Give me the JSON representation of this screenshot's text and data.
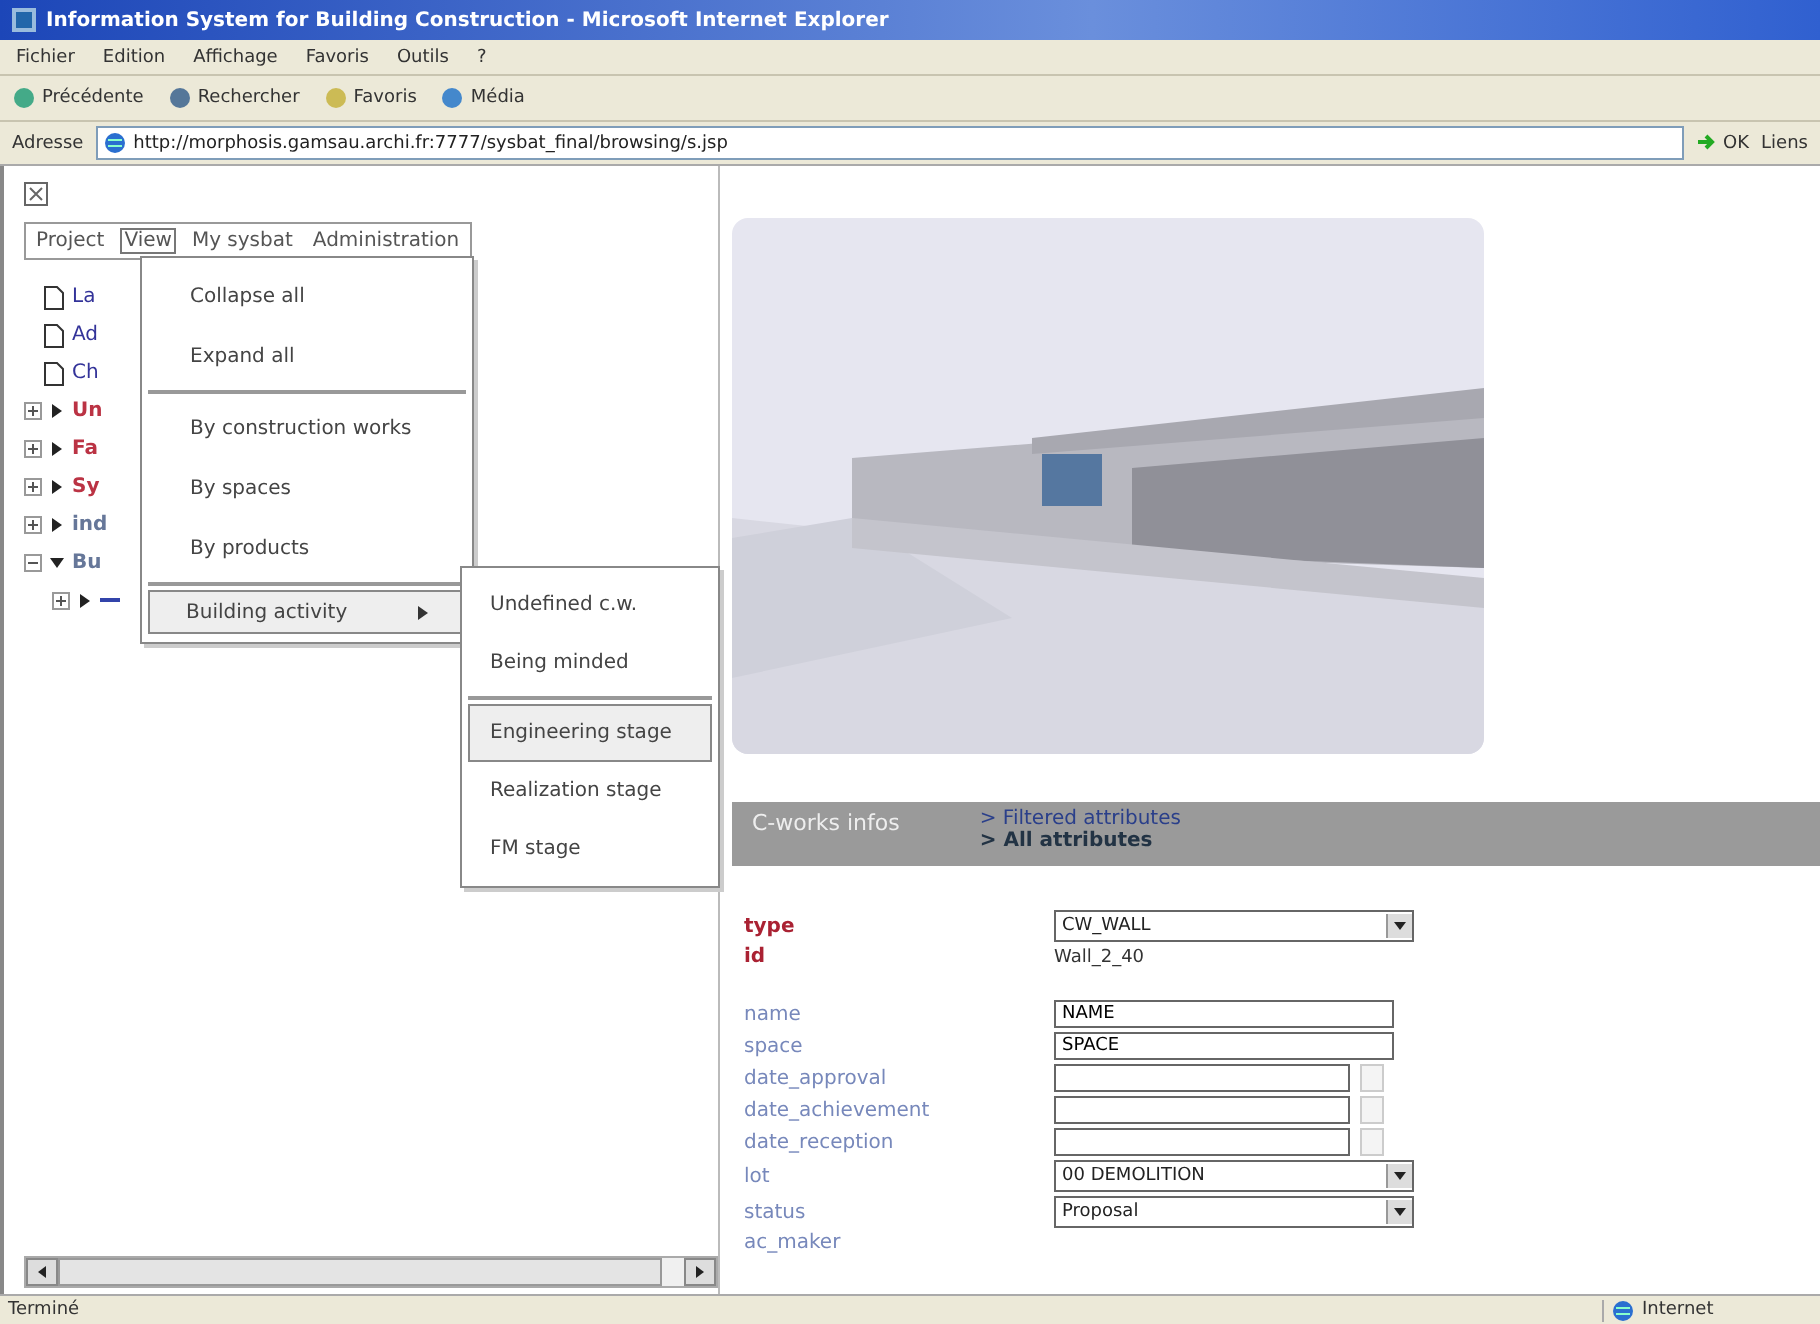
{
  "window": {
    "title": "Information System for Building Construction - Microsoft Internet Explorer"
  },
  "menu_bar": [
    "Fichier",
    "Edition",
    "Affichage",
    "Favoris",
    "Outils",
    "?"
  ],
  "toolbar": [
    "Précédente",
    "Rechercher",
    "Favoris",
    "Média"
  ],
  "address": {
    "label": "Adresse",
    "url": "http://morphosis.gamsau.archi.fr:7777/sysbat_final/browsing/s.jsp",
    "go": "OK",
    "links": "Liens"
  },
  "app_menu": [
    {
      "label": "Project",
      "selected": false
    },
    {
      "label": "View",
      "selected": true
    },
    {
      "label": "My sysbat",
      "selected": false
    },
    {
      "label": "Administration",
      "selected": false
    }
  ],
  "tree": [
    {
      "kind": "document",
      "label": "La",
      "color": "#333399"
    },
    {
      "kind": "document",
      "label": "Ad",
      "color": "#333399"
    },
    {
      "kind": "document",
      "label": "Ch",
      "color": "#333399"
    },
    {
      "kind": "folder",
      "label": "Un",
      "color": "#bb3344",
      "expanded": false
    },
    {
      "kind": "folder",
      "label": "Fa",
      "color": "#bb3344",
      "expanded": false
    },
    {
      "kind": "folder",
      "label": "Sy",
      "color": "#bb3344",
      "expanded": false
    },
    {
      "kind": "folder",
      "label": "ind",
      "color": "#667799",
      "expanded": false
    },
    {
      "kind": "folder",
      "label": "Bu",
      "color": "#667799",
      "expanded": true,
      "children": [
        {
          "kind": "folder",
          "color": "#3344aa",
          "expanded": false
        }
      ]
    }
  ],
  "view_menu": [
    {
      "kind": "item",
      "label": "Collapse all",
      "selected": false
    },
    {
      "kind": "item",
      "label": "Expand all",
      "selected": false
    },
    {
      "kind": "divider"
    },
    {
      "kind": "item",
      "label": "By construction works",
      "selected": false
    },
    {
      "kind": "item",
      "label": "By spaces",
      "selected": false
    },
    {
      "kind": "item",
      "label": "By products",
      "selected": false
    },
    {
      "kind": "divider"
    },
    {
      "kind": "submenu",
      "label": "Building activity",
      "selected": true
    }
  ],
  "submenu": [
    {
      "kind": "item",
      "label": "Undefined c.w.",
      "selected": false
    },
    {
      "kind": "item",
      "label": "Being minded",
      "selected": false
    },
    {
      "kind": "divider"
    },
    {
      "kind": "item",
      "label": "Engineering stage",
      "selected": true
    },
    {
      "kind": "item",
      "label": "Realization stage",
      "selected": false
    },
    {
      "kind": "item",
      "label": "FM stage",
      "selected": false
    }
  ],
  "details": {
    "title": "C-works infos",
    "links": [
      {
        "label": "> Filtered attributes",
        "selected": false
      },
      {
        "label": "> All attributes",
        "selected": true
      }
    ],
    "fields": [
      {
        "label": "type",
        "kind": "select",
        "value": "CW_WALL",
        "required": true
      },
      {
        "label": "id",
        "kind": "text",
        "value": "Wall_2_40",
        "required": true
      },
      {
        "kind": "gap"
      },
      {
        "label": "name",
        "kind": "input",
        "value": "NAME",
        "required": false
      },
      {
        "label": "space",
        "kind": "input",
        "value": "SPACE",
        "required": false
      },
      {
        "label": "date_approval",
        "kind": "date",
        "required": false
      },
      {
        "label": "date_achievement",
        "kind": "date",
        "required": false
      },
      {
        "label": "date_reception",
        "kind": "date",
        "required": false
      },
      {
        "label": "lot",
        "kind": "select",
        "value": "00 DEMOLITION",
        "required": false
      },
      {
        "label": "status",
        "kind": "select",
        "value": "Proposal",
        "required": false
      },
      {
        "label": "ac_maker",
        "kind": "label",
        "required": false
      }
    ]
  },
  "status_bar": {
    "text": "Terminé",
    "zone": "Internet"
  }
}
